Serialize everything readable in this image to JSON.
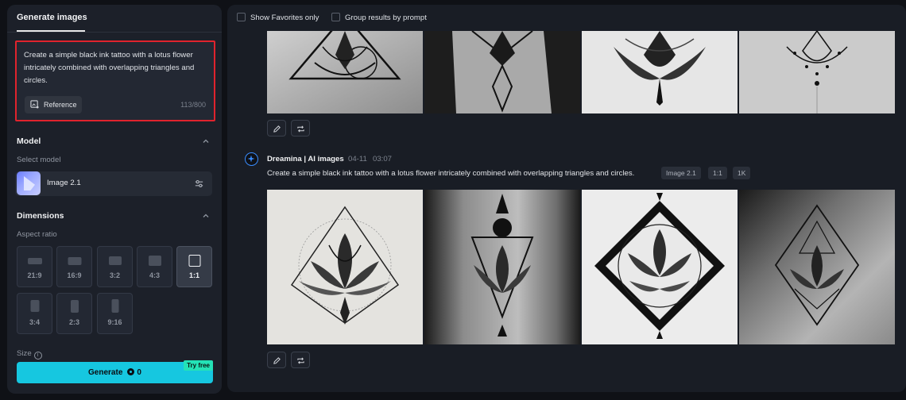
{
  "left_panel": {
    "title": "Generate images",
    "prompt_text": "Create a simple black ink tattoo with a lotus flower intricately combined with overlapping triangles and circles.",
    "reference_label": "Reference",
    "char_count": "113/800",
    "model_section": "Model",
    "select_model_label": "Select model",
    "model_name": "Image 2.1",
    "dimensions_section": "Dimensions",
    "aspect_ratio_label": "Aspect ratio",
    "aspect_ratios": [
      "21:9",
      "16:9",
      "3:2",
      "4:3",
      "1:1",
      "3:4",
      "2:3",
      "9:16"
    ],
    "selected_ratio": "1:1",
    "size_label": "Size",
    "generate_label": "Generate",
    "credit_count": "0",
    "try_free": "Try free"
  },
  "right_panel": {
    "show_favorites": "Show Favorites only",
    "group_by_prompt": "Group results by prompt",
    "entry": {
      "author": "Dreamina | AI images",
      "date": "04-11",
      "time": "03:07",
      "prompt": "Create a simple black ink tattoo with a lotus flower intricately combined with overlapping triangles and circles.",
      "tags": [
        "Image 2.1",
        "1:1",
        "1K"
      ]
    }
  },
  "colors": {
    "accent": "#16c7e0",
    "highlight_border": "#e0232d",
    "try_free_bg": "#24e2b6"
  },
  "icons": {
    "reference": "reference-image-icon",
    "settings": "sliders-icon",
    "edit": "pencil-icon",
    "regenerate": "repeat-icon",
    "chevron": "chevron-up-icon",
    "info": "info-icon"
  }
}
